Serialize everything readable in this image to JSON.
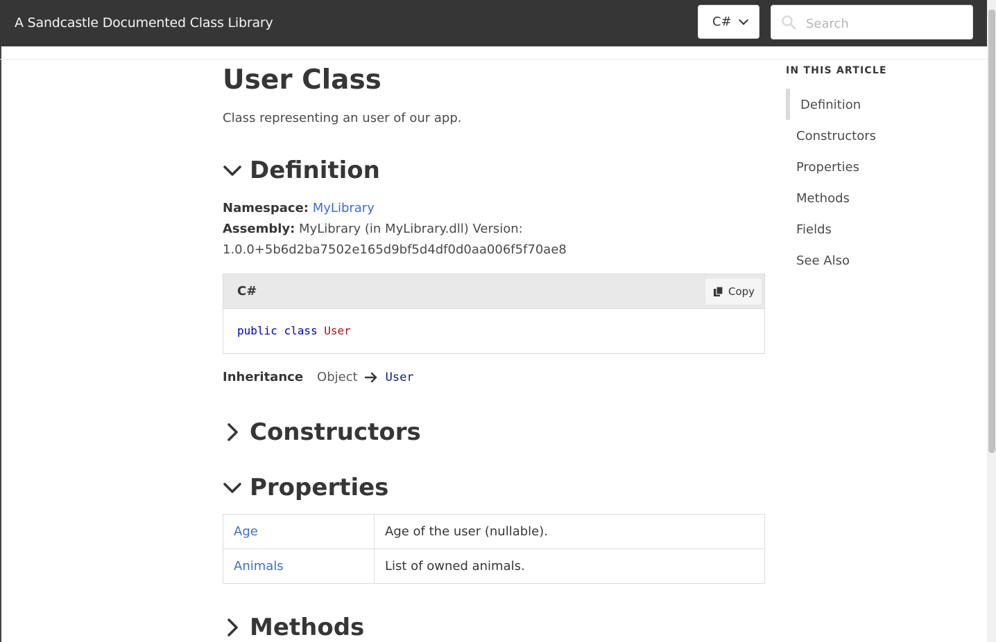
{
  "header": {
    "site_title": "A Sandcastle Documented Class Library",
    "language": "C#",
    "search_placeholder": "Search"
  },
  "page": {
    "title": "User Class",
    "summary": "Class representing an user of our app."
  },
  "definition": {
    "heading": "Definition",
    "expanded": true,
    "namespace_label": "Namespace:",
    "namespace_value": "MyLibrary",
    "assembly_label": "Assembly:",
    "assembly_value": "MyLibrary (in MyLibrary.dll) Version:",
    "version": "1.0.0+5b6d2ba7502e165d9bf5d4df0d0aa006f5f70ae8",
    "code": {
      "language": "C#",
      "copy_label": "Copy",
      "keyword_public": "public",
      "keyword_class": "class",
      "type_name": "User"
    },
    "inheritance_label": "Inheritance",
    "inheritance_base": "Object",
    "inheritance_self": "User"
  },
  "constructors": {
    "heading": "Constructors",
    "expanded": false
  },
  "properties": {
    "heading": "Properties",
    "expanded": true,
    "rows": [
      {
        "name": "Age",
        "description": "Age of the user (nullable)."
      },
      {
        "name": "Animals",
        "description": "List of owned animals."
      }
    ]
  },
  "methods": {
    "heading": "Methods",
    "expanded": false
  },
  "toc": {
    "title": "IN THIS ARTICLE",
    "items": [
      "Definition",
      "Constructors",
      "Properties",
      "Methods",
      "Fields",
      "See Also"
    ],
    "active": "Definition"
  },
  "colors": {
    "topbar": "#363636",
    "link": "#3e6fc7",
    "keyword": "#0000c0",
    "type_name": "#a31515"
  },
  "icons": {
    "search": "search-icon",
    "language_dropdown": "chevron-down-icon",
    "copy": "copy-icon",
    "expanded": "chevron-down-icon",
    "collapsed": "chevron-right-icon",
    "inheritance_arrow": "arrow-right-icon"
  }
}
